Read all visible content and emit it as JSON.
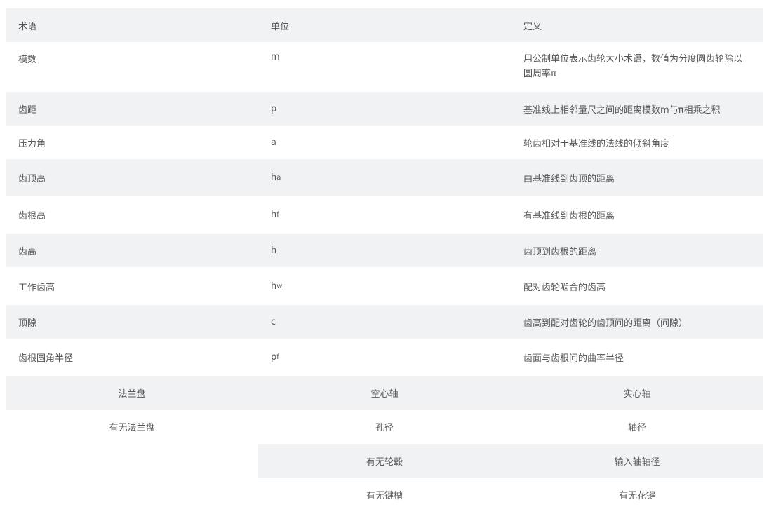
{
  "terms_table": {
    "headers": {
      "term": "术语",
      "unit": "单位",
      "definition": "定义"
    },
    "rows": [
      {
        "term": "模数",
        "symbol": "m",
        "sub": "",
        "definition": "用公制单位表示齿轮大小术语，数值为分度圆齿轮除以圆周率π"
      },
      {
        "term": "齿距",
        "symbol": "p",
        "sub": "",
        "definition": "基准线上相邻量尺之间的距离模数m与π相乘之积"
      },
      {
        "term": "压力角",
        "symbol": "a",
        "sub": "",
        "definition": "轮齿相对于基准线的法线的倾斜角度"
      },
      {
        "term": "齿顶高",
        "symbol": "h",
        "sub": "a",
        "definition": "由基准线到齿顶的距离"
      },
      {
        "term": "齿根高",
        "symbol": "h",
        "sub": "f",
        "definition": "有基准线到齿根的距离"
      },
      {
        "term": "齿高",
        "symbol": "h",
        "sub": "",
        "definition": "齿顶到齿根的距离"
      },
      {
        "term": "工作齿高",
        "symbol": "h",
        "sub": "w",
        "definition": "配对齿轮啮合的齿高"
      },
      {
        "term": "顶隙",
        "symbol": "c",
        "sub": "",
        "definition": "齿高到配对齿轮的齿顶间的距离（间隙）"
      },
      {
        "term": "齿根圆角半径",
        "symbol": "p",
        "sub": "f",
        "definition": "齿面与齿根间的曲率半径"
      }
    ]
  },
  "shaft_table": {
    "headers": {
      "c1": "法兰盘",
      "c2": "空心轴",
      "c3": "实心轴"
    },
    "rows": [
      {
        "c1": "有无法兰盘",
        "c2": "孔径",
        "c3": "轴径"
      },
      {
        "c1": "",
        "c2": "有无轮毂",
        "c3": "输入轴轴径"
      },
      {
        "c1": "",
        "c2": "有无键槽",
        "c3": "有无花键"
      }
    ]
  }
}
